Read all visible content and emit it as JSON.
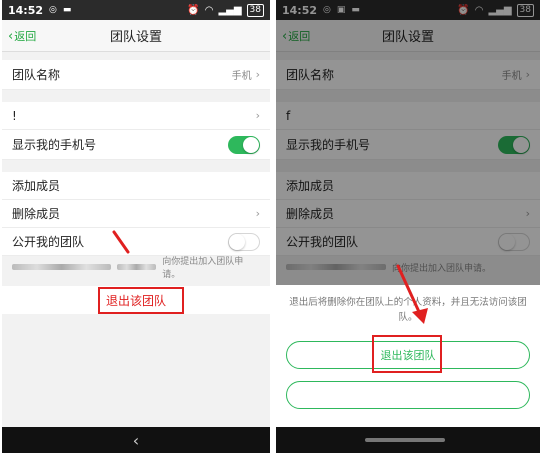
{
  "left_screen": {
    "status": {
      "time": "14:52",
      "battery": "38"
    },
    "nav": {
      "back": "返回",
      "title": "团队设置"
    },
    "rows": {
      "team_name": {
        "label": "团队名称",
        "value": "手机"
      },
      "nickname": {
        "label": "!"
      },
      "show_phone": {
        "label": "显示我的手机号"
      },
      "add_member": {
        "label": "添加成员"
      },
      "remove_member": {
        "label": "删除成员"
      },
      "public_team": {
        "label": "公开我的团队"
      }
    },
    "hint": "向你提出加入团队申请。",
    "exit_label": "退出该团队"
  },
  "right_screen": {
    "status": {
      "time": "14:52",
      "battery": "38"
    },
    "nav": {
      "back": "返回",
      "title": "团队设置"
    },
    "rows": {
      "team_name": {
        "label": "团队名称",
        "value": "手机"
      },
      "nickname": {
        "label": "f"
      },
      "show_phone": {
        "label": "显示我的手机号"
      },
      "add_member": {
        "label": "添加成员"
      },
      "remove_member": {
        "label": "删除成员"
      },
      "public_team": {
        "label": "公开我的团队"
      }
    },
    "hint": "向你提出加入团队申请。",
    "sheet": {
      "message": "退出后将删除你在团队上的个人资料，并且无法访问该团队。",
      "confirm_label": "退出该团队"
    }
  },
  "colors": {
    "accent": "#2eb85c",
    "danger": "#e02020",
    "back_link": "#23a842"
  },
  "icons": [
    "wifi-icon",
    "signal-icon",
    "alarm-icon",
    "battery-icon",
    "chevron-left-icon",
    "chevron-right-icon",
    "back-arrow-icon"
  ]
}
